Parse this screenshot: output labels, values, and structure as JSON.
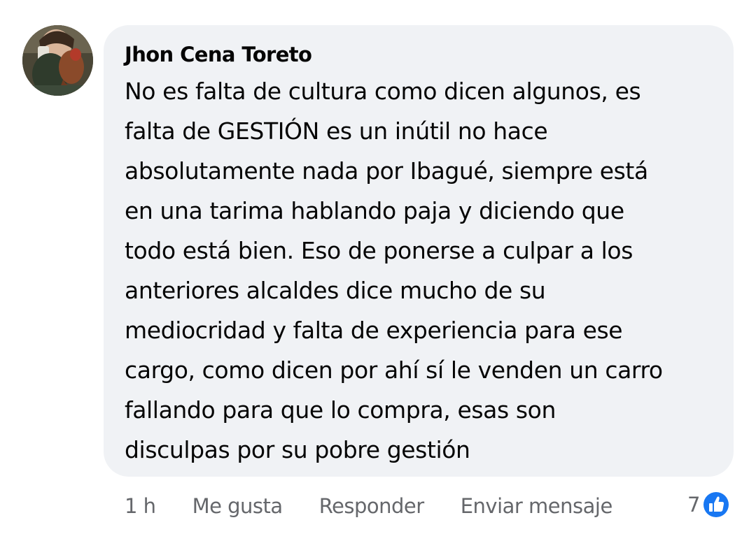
{
  "comment": {
    "author": "Jhon Cena Toreto",
    "text": "No es falta de cultura como dicen algunos, es\nfalta de GESTIÓN es un inútil no hace\nabsolutamente nada por Ibagué, siempre está\nen una tarima hablando paja y diciendo que\ntodo está bien. Eso de ponerse a culpar a los\nanteriores alcaldes dice mucho de su\nmediocridad y falta de experiencia para ese\ncargo, como dicen por ahí sí le venden un carro\nfallando para que lo compra,  esas son\ndisculpas por su pobre gestión",
    "avatar_icon": "profile-photo"
  },
  "actions": {
    "time": "1 h",
    "like_label": "Me gusta",
    "reply_label": "Responder",
    "message_label": "Enviar mensaje"
  },
  "reactions": {
    "count": "7",
    "icon": "like-thumbs-up-icon",
    "color": "#1877f2"
  },
  "colors": {
    "bubble": "#f0f2f5",
    "text": "#050505",
    "secondary": "#65676b"
  }
}
